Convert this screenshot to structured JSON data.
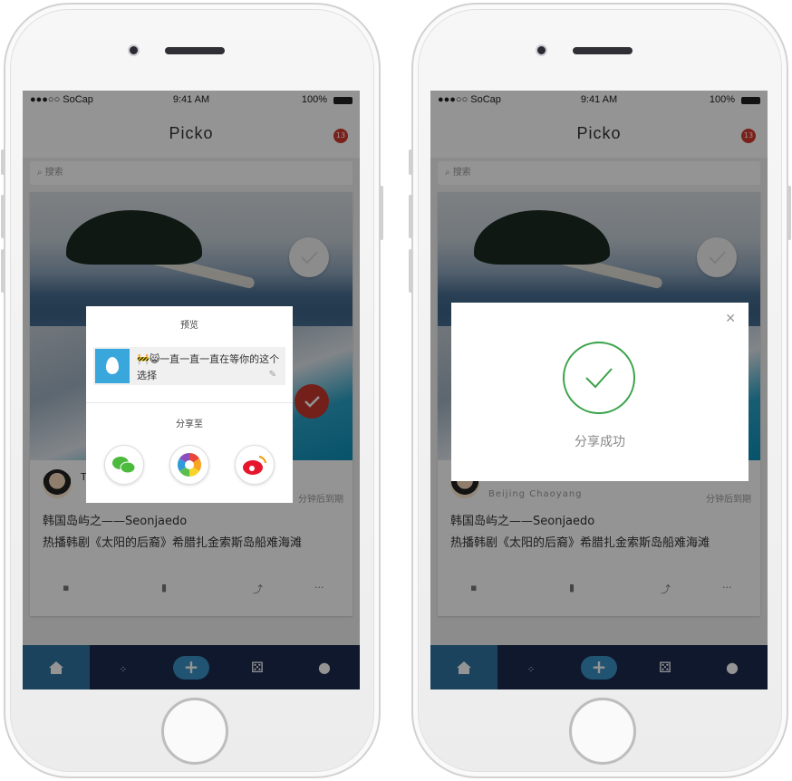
{
  "status": {
    "carrier": "●●●○○ SoCap",
    "time": "9:41 AM",
    "battery": "100%"
  },
  "nav": {
    "title": "Picko",
    "badge": "13"
  },
  "search": {
    "placeholder": "搜索"
  },
  "post": {
    "author_initial": "T",
    "location": "Beijing Chaoyang",
    "expire": "分钟后到期",
    "title": "韩国岛屿之——Seonjaedo",
    "body": "热播韩剧《太阳的后裔》希腊扎金索斯岛船难海滩"
  },
  "share_dialog": {
    "title": "预览",
    "preview_text": "🚧😸一直一直一直在等你的这个选择",
    "share_to": "分享至",
    "targets": [
      "wechat-icon",
      "moments-icon",
      "weibo-icon"
    ]
  },
  "success_dialog": {
    "message": "分享成功"
  },
  "tabbar": {
    "tabs": [
      "home-icon",
      "discover-icon",
      "add-icon",
      "dice-icon",
      "profile-icon"
    ]
  }
}
